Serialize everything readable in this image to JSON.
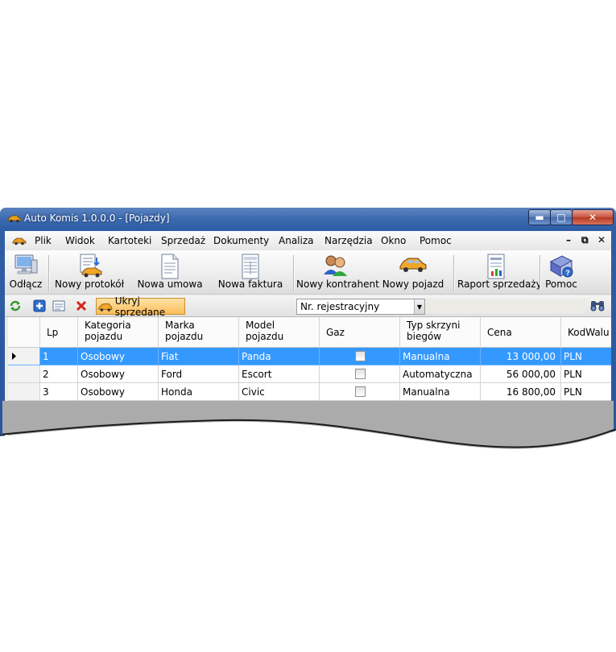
{
  "window": {
    "title": "Auto Komis 1.0.0.0 - [Pojazdy]",
    "min_glyph": "▬",
    "max_glyph": "□",
    "close_glyph": "✕"
  },
  "menu": {
    "items": [
      "Plik",
      "Widok",
      "Kartoteki",
      "Sprzedaż",
      "Dokumenty",
      "Analiza",
      "Narzędzia",
      "Okno",
      "Pomoc"
    ],
    "mdi_min": "–",
    "mdi_restore": "⧉",
    "mdi_close": "✕"
  },
  "toolbar": {
    "disconnect": "Odłącz",
    "new_protocol": "Nowy protokół",
    "new_contract": "Nowa umowa",
    "new_invoice": "Nowa faktura",
    "new_contractor": "Nowy kontrahent",
    "new_vehicle": "Nowy pojazd",
    "sales_report": "Raport sprzedaży",
    "help": "Pomoc"
  },
  "filter_bar": {
    "hide_sold_label": "Ukryj sprzedane",
    "search_field_value": "Nr. rejestracyjny",
    "search_text": ""
  },
  "grid": {
    "columns": [
      "Lp",
      "Kategoria\npojazdu",
      "Marka\npojazdu",
      "Model\npojazdu",
      "Gaz",
      "Typ skrzyni\nbiegów",
      "Cena",
      "KodWalu"
    ],
    "rows": [
      {
        "lp": "1",
        "kategoria": "Osobowy",
        "marka": "Fiat",
        "model": "Panda",
        "gaz": false,
        "skrzynia": "Manualna",
        "cena": "13 000,00",
        "waluta": "PLN"
      },
      {
        "lp": "2",
        "kategoria": "Osobowy",
        "marka": "Ford",
        "model": "Escort",
        "gaz": false,
        "skrzynia": "Automatyczna",
        "cena": "56 000,00",
        "waluta": "PLN"
      },
      {
        "lp": "3",
        "kategoria": "Osobowy",
        "marka": "Honda",
        "model": "Civic",
        "gaz": false,
        "skrzynia": "Manualna",
        "cena": "16 800,00",
        "waluta": "PLN"
      }
    ],
    "selected_row": 0
  },
  "colors": {
    "title_bar": "#3d6bb0",
    "selection": "#3399ff",
    "hide_sold_button": "#fbbc5a",
    "grid_background": "#ababab"
  }
}
